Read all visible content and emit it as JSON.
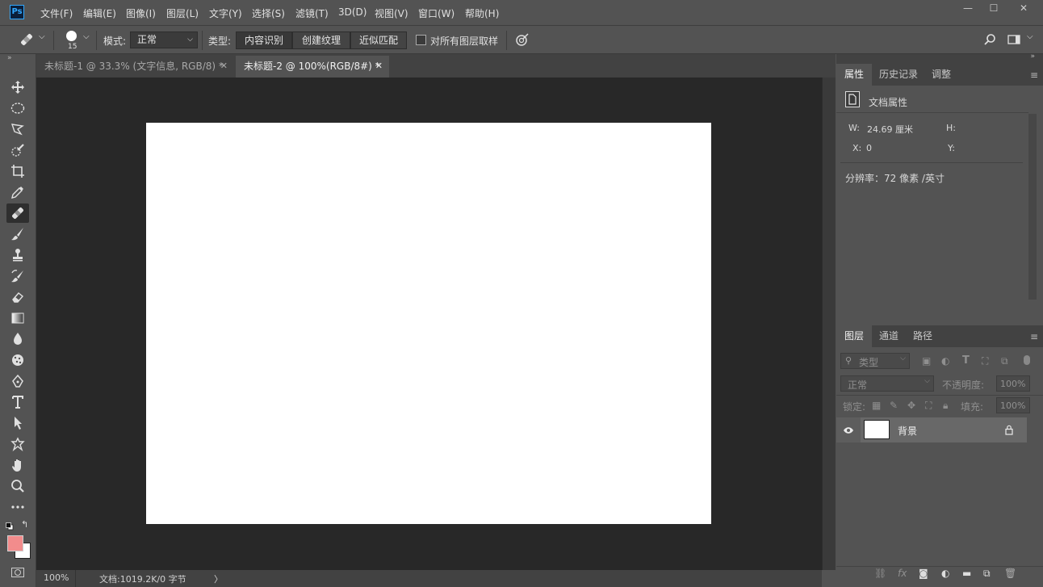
{
  "menubar": {
    "logo": "Ps",
    "items": [
      "文件(F)",
      "编辑(E)",
      "图像(I)",
      "图层(L)",
      "文字(Y)",
      "选择(S)",
      "滤镜(T)",
      "3D(D)",
      "视图(V)",
      "窗口(W)",
      "帮助(H)"
    ],
    "window_controls": [
      "—",
      "☐",
      "✕"
    ]
  },
  "options": {
    "brush_size": "15",
    "mode_label": "模式:",
    "mode_value": "正常",
    "type_label": "类型:",
    "type_options": [
      "内容识别",
      "创建纹理",
      "近似匹配"
    ],
    "sample_all_label": "对所有图层取样"
  },
  "tabs": [
    {
      "label": "未标题-1 @ 33.3% (文字信息, RGB/8) *",
      "close": "✕"
    },
    {
      "label": "未标题-2 @ 100%(RGB/8#) *",
      "close": "✕"
    }
  ],
  "status": {
    "zoom": "100%",
    "doc_info": "文档:1019.2K/0 字节",
    "arrow": "〉"
  },
  "properties_panel": {
    "tabs": [
      "属性",
      "历史记录",
      "调整"
    ],
    "section_title": "文档属性",
    "w_label": "W:",
    "w_value": "24.69 厘米",
    "h_label": "H:",
    "x_label": "X:",
    "x_value": "0",
    "y_label": "Y:",
    "resolution": "分辨率：72 像素 /英寸"
  },
  "layers_panel": {
    "tabs": [
      "图层",
      "通道",
      "路径"
    ],
    "filter_placeholder": "类型",
    "blend_mode": "正常",
    "opacity_label": "不透明度:",
    "opacity_value": "100%",
    "lock_label": "锁定:",
    "fill_label": "填充:",
    "fill_value": "100%",
    "layers": [
      {
        "name": "背景"
      }
    ]
  },
  "colors": {
    "foreground": "#f28c8c",
    "background": "#ffffff",
    "accent": "#31a8ff"
  }
}
